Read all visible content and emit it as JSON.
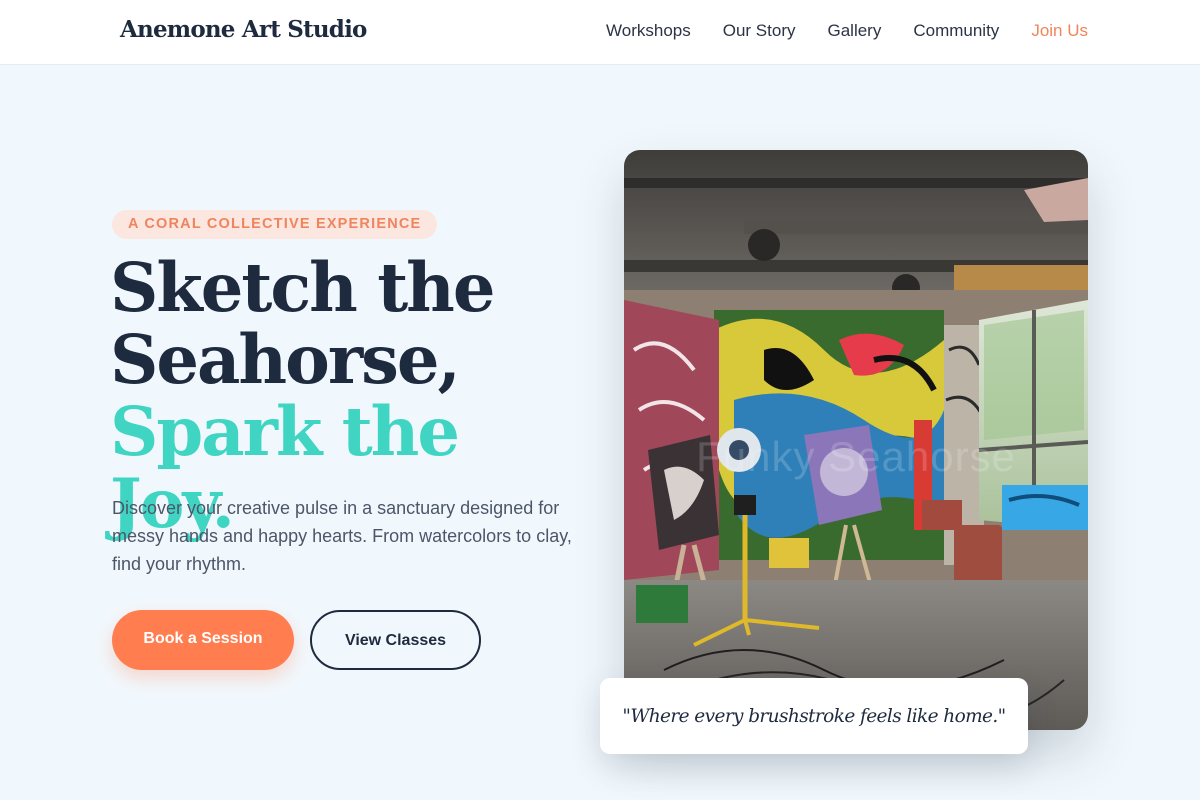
{
  "header": {
    "brand": "Anemone Art Studio",
    "nav": [
      {
        "label": "Workshops"
      },
      {
        "label": "Our Story"
      },
      {
        "label": "Gallery"
      },
      {
        "label": "Community"
      },
      {
        "label": "Join Us"
      }
    ]
  },
  "hero": {
    "eyebrow": "A Coral Collective Experience",
    "headline_line1": "Sketch the",
    "headline_line2": "Seahorse,",
    "headline_accent": "Spark the Joy.",
    "lead": "Discover your creative pulse in a sanctuary designed for messy hands and happy hearts. From watercolors to clay, find your rhythm.",
    "primary_cta": "Book a Session",
    "secondary_cta": "View Classes"
  },
  "photo": {
    "watermark": "Funky Seahorse",
    "quote": "\"Where every brushstroke feels like home.\""
  },
  "colors": {
    "brand_navy": "#1e2a3e",
    "accent_coral": "#ff7d4f",
    "accent_teal": "#40d5c3",
    "page_background": "#f1f8fd"
  }
}
